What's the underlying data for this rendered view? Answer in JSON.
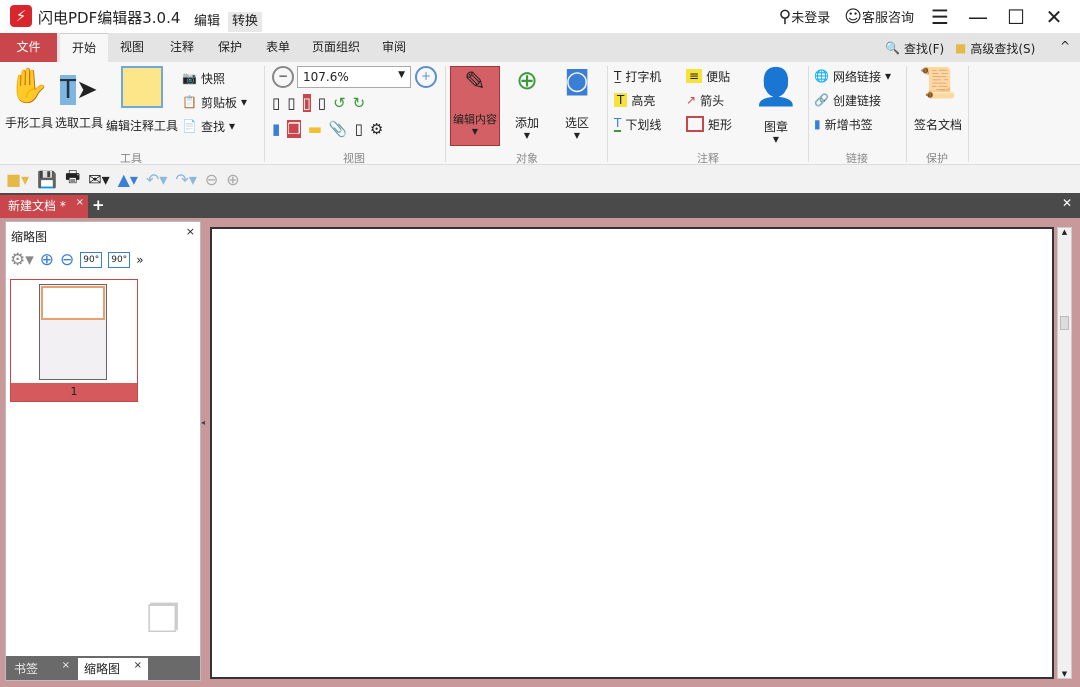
{
  "app": {
    "title": "闪电PDF编辑器3.0.4",
    "mode_tabs": [
      "编辑",
      "转换"
    ],
    "login": "未登录",
    "support": "客服咨询"
  },
  "menu": {
    "items": [
      "文件",
      "开始",
      "视图",
      "注释",
      "保护",
      "表单",
      "页面组织",
      "审阅"
    ],
    "find": "查找(F)",
    "advanced_find": "高级查找(S)"
  },
  "ribbon": {
    "tools": {
      "label": "工具",
      "hand": "手形工具",
      "select": "选取工具",
      "edit_annot": "编辑注释工具",
      "snapshot": "快照",
      "clipboard": "剪贴板",
      "find": "查找"
    },
    "view": {
      "label": "视图",
      "zoom": "107.6%"
    },
    "object": {
      "label": "对象",
      "edit_content": "编辑内容",
      "add": "添加",
      "select_area": "选区"
    },
    "annot": {
      "label": "注释",
      "typewriter": "打字机",
      "sticky": "便贴",
      "highlight": "高亮",
      "arrow": "箭头",
      "underline": "下划线",
      "rect": "矩形",
      "stamp": "图章"
    },
    "link": {
      "label": "链接",
      "web_link": "网络链接",
      "create_link": "创建链接",
      "new_bookmark": "新增书签"
    },
    "protect": {
      "label": "保护",
      "sign": "签名文档"
    }
  },
  "doc_tab": {
    "title": "新建文档 *"
  },
  "panel": {
    "title": "缩略图",
    "page_number": "1",
    "rot_left": "90°",
    "rot_right": "90°",
    "bottom_tabs": [
      "书签",
      "缩略图"
    ]
  },
  "colors": {
    "accent": "#c9474c"
  }
}
